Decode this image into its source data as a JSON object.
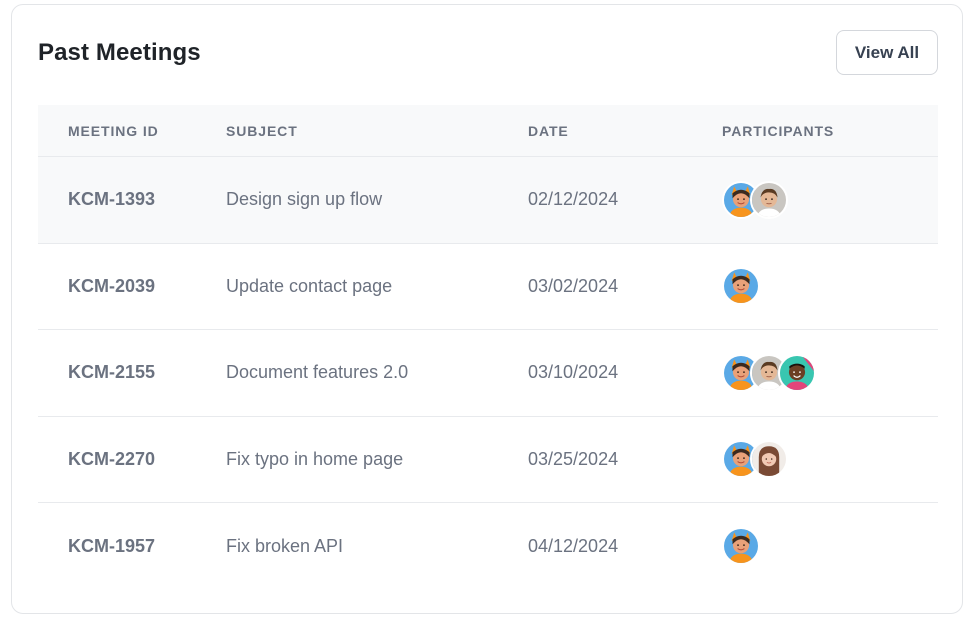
{
  "card": {
    "title": "Past Meetings",
    "view_all_label": "View All"
  },
  "table": {
    "headers": [
      "MEETING ID",
      "SUBJECT",
      "DATE",
      "PARTICIPANTS"
    ],
    "rows": [
      {
        "id": "KCM-1393",
        "subject": "Design sign up flow",
        "date": "02/12/2024",
        "participants": [
          "avatar-a",
          "avatar-b"
        ]
      },
      {
        "id": "KCM-2039",
        "subject": "Update contact page",
        "date": "03/02/2024",
        "participants": [
          "avatar-a"
        ]
      },
      {
        "id": "KCM-2155",
        "subject": "Document features 2.0",
        "date": "03/10/2024",
        "participants": [
          "avatar-a",
          "avatar-b",
          "avatar-c"
        ]
      },
      {
        "id": "KCM-2270",
        "subject": "Fix typo in home page",
        "date": "03/25/2024",
        "participants": [
          "avatar-a",
          "avatar-d"
        ]
      },
      {
        "id": "KCM-1957",
        "subject": "Fix broken API",
        "date": "04/12/2024",
        "participants": [
          "avatar-a"
        ]
      }
    ]
  },
  "colors": {
    "highlight_row": "#f8f9fa",
    "border": "#e3e5e8",
    "text_muted": "#6b7280",
    "title": "#1f2328"
  }
}
